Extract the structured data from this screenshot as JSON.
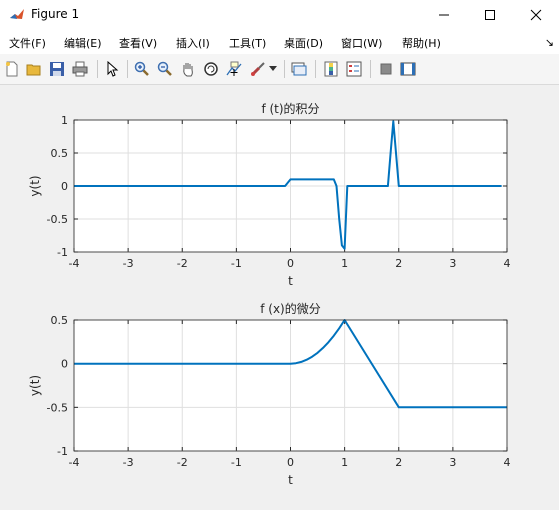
{
  "window": {
    "title": "Figure 1"
  },
  "menu": [
    "文件(F)",
    "编辑(E)",
    "查看(V)",
    "插入(I)",
    "工具(T)",
    "桌面(D)",
    "窗口(W)",
    "帮助(H)"
  ],
  "toolbar_icons": [
    "new-figure-icon",
    "open-icon",
    "save-icon",
    "print-icon",
    "pointer-icon",
    "zoom-in-icon",
    "zoom-out-icon",
    "pan-icon",
    "rotate-3d-icon",
    "data-cursor-icon",
    "brush-icon",
    "brush-dropdown-icon",
    "link-plot-icon",
    "insert-colorbar-icon",
    "insert-legend-icon",
    "hide-plot-tools-icon",
    "show-plot-tools-icon"
  ],
  "colors": {
    "line": "#0072bd",
    "axes_bg": "#ffffff",
    "grid": "#dfdfdf",
    "figure_bg": "#f0f0f0"
  },
  "chart_data": [
    {
      "type": "line",
      "title": "f (t)的积分",
      "xlabel": "t",
      "ylabel": "y(t)",
      "xlim": [
        -4,
        4
      ],
      "ylim": [
        -1,
        1
      ],
      "xticks": [
        "-4",
        "-3",
        "-2",
        "-1",
        "0",
        "1",
        "2",
        "3",
        "4"
      ],
      "yticks": [
        "1",
        "0.5",
        "0",
        "-0.5",
        "-1"
      ],
      "grid": true,
      "series": [
        {
          "x": [
            -4,
            -0.1,
            0,
            0.8,
            0.85,
            0.9,
            0.95,
            1.0,
            1.05,
            1.1,
            1.8,
            1.85,
            1.9,
            1.95,
            2.0,
            3.9
          ],
          "y": [
            0,
            0,
            0.1,
            0.1,
            0,
            -0.5,
            -0.9,
            -0.95,
            0,
            0,
            0,
            0.5,
            0.98,
            0.5,
            0,
            0
          ]
        }
      ]
    },
    {
      "type": "line",
      "title": "f (x)的微分",
      "xlabel": "t",
      "ylabel": "y(t)",
      "xlim": [
        -4,
        4
      ],
      "ylim": [
        -1,
        0.5
      ],
      "xticks": [
        "-4",
        "-3",
        "-2",
        "-1",
        "0",
        "1",
        "2",
        "3",
        "4"
      ],
      "yticks": [
        "0.5",
        "0",
        "-0.5",
        "-1"
      ],
      "grid": true,
      "series": [
        {
          "x": [
            -4,
            0,
            0.1,
            0.2,
            0.3,
            0.4,
            0.5,
            0.6,
            0.7,
            0.8,
            0.9,
            1,
            2,
            4
          ],
          "y": [
            0,
            0,
            0.005,
            0.02,
            0.045,
            0.08,
            0.125,
            0.18,
            0.245,
            0.32,
            0.405,
            0.5,
            -0.5,
            -0.5
          ]
        }
      ]
    }
  ]
}
